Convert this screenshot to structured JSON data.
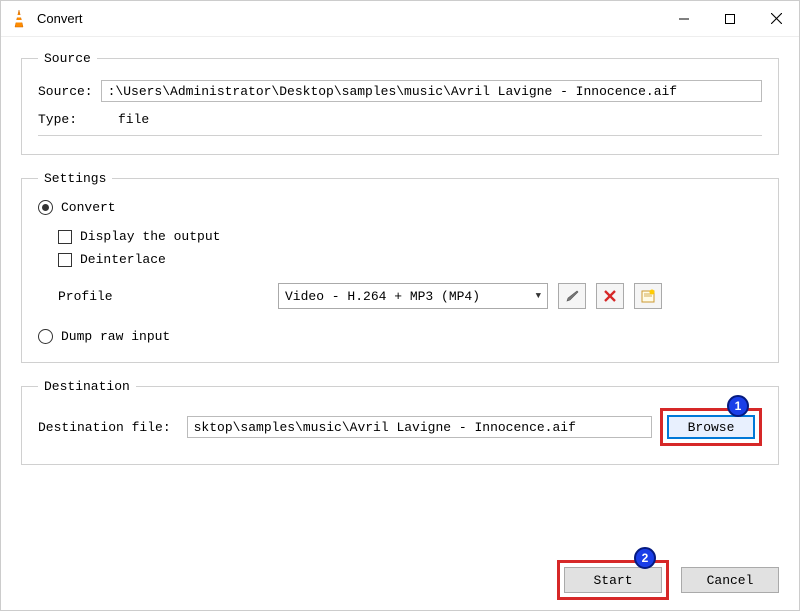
{
  "window": {
    "title": "Convert"
  },
  "source": {
    "legend": "Source",
    "source_label": "Source:",
    "source_value": ":\\Users\\Administrator\\Desktop\\samples\\music\\Avril Lavigne - Innocence.aif",
    "type_label": "Type:",
    "type_value": "file"
  },
  "settings": {
    "legend": "Settings",
    "convert_label": "Convert",
    "display_output_label": "Display the output",
    "deinterlace_label": "Deinterlace",
    "profile_label": "Profile",
    "profile_value": "Video - H.264 + MP3 (MP4)",
    "dump_raw_label": "Dump raw input"
  },
  "destination": {
    "legend": "Destination",
    "file_label": "Destination file:",
    "file_value": "sktop\\samples\\music\\Avril Lavigne - Innocence.aif",
    "browse_label": "Browse"
  },
  "buttons": {
    "start": "Start",
    "cancel": "Cancel"
  },
  "annotations": {
    "badge1": "1",
    "badge2": "2"
  }
}
